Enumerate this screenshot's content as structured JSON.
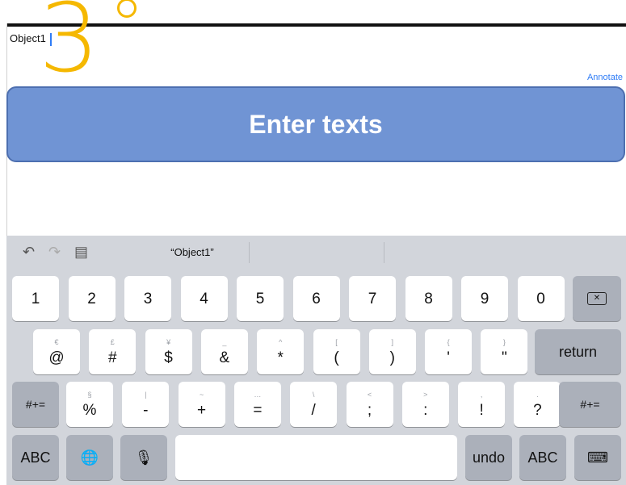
{
  "step_number": "3",
  "text_field": {
    "value": "Object1"
  },
  "annotate_label": "Annotate",
  "banner_text": "Enter texts",
  "toolbar": {
    "undo_icon": "undo-arrow-icon",
    "redo_icon": "redo-arrow-icon",
    "paste_icon": "clipboard-icon",
    "suggestion": "“Object1”"
  },
  "keys": {
    "row1": [
      "1",
      "2",
      "3",
      "4",
      "5",
      "6",
      "7",
      "8",
      "9",
      "0"
    ],
    "row2": [
      {
        "main": "@",
        "alt": "€"
      },
      {
        "main": "#",
        "alt": "£"
      },
      {
        "main": "$",
        "alt": "¥"
      },
      {
        "main": "&",
        "alt": "_"
      },
      {
        "main": "*",
        "alt": "^"
      },
      {
        "main": "(",
        "alt": "["
      },
      {
        "main": ")",
        "alt": "]"
      },
      {
        "main": "'",
        "alt": "{"
      },
      {
        "main": "\"",
        "alt": "}"
      }
    ],
    "row3": [
      {
        "main": "%",
        "alt": "§"
      },
      {
        "main": "-",
        "alt": "|"
      },
      {
        "main": "+",
        "alt": "~"
      },
      {
        "main": "=",
        "alt": "…"
      },
      {
        "main": "/",
        "alt": "\\"
      },
      {
        "main": ";",
        "alt": "<"
      },
      {
        "main": ":",
        "alt": ">"
      },
      {
        "main": "!",
        "alt": ","
      },
      {
        "main": "?",
        "alt": "."
      }
    ],
    "return_label": "return",
    "symbols_label": "#+=",
    "abc_label": "ABC",
    "undo_label": "undo"
  },
  "colors": {
    "accent": "#2f7cf6",
    "banner": "#7094d4",
    "step_number": "#f5b800"
  }
}
